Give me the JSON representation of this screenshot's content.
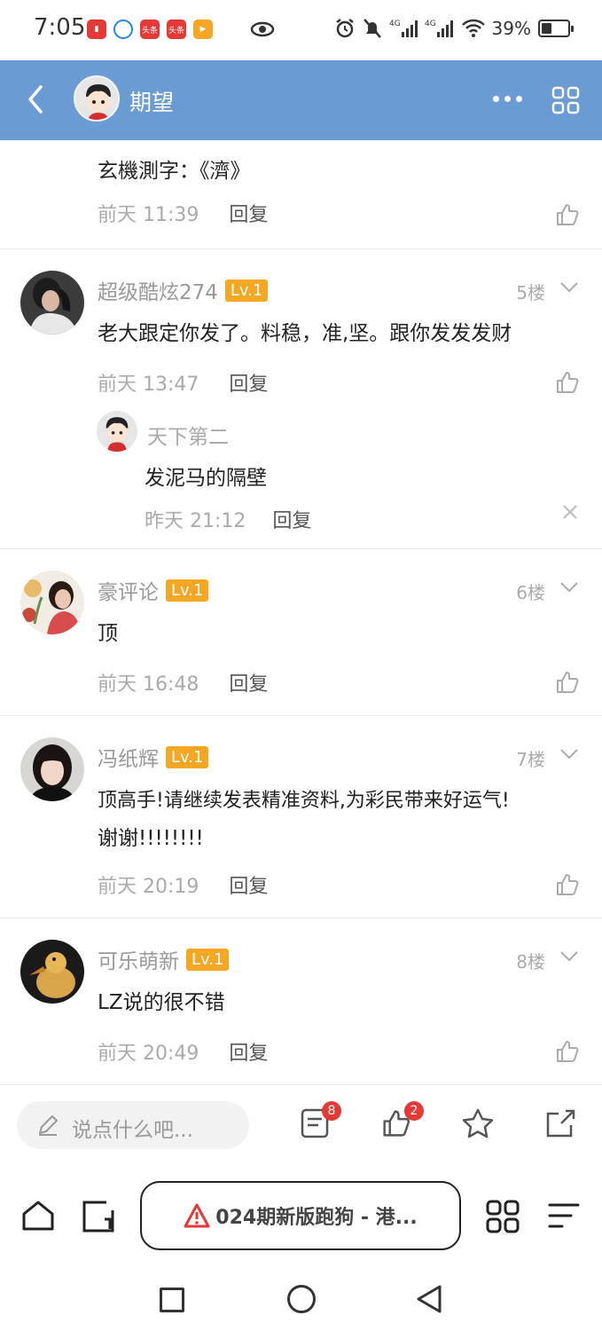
{
  "status_bar": {
    "time": "7:05",
    "notif_badges": [
      "头条",
      "头条"
    ],
    "signal_1": "4G",
    "signal_2": "4G",
    "battery": "39%"
  },
  "header": {
    "title": "期望"
  },
  "partial_comment": {
    "text": "玄機測字：《濟》",
    "time": "前天 11:39",
    "reply": "回复"
  },
  "comments": [
    {
      "username": "超级酷炫274",
      "level": "Lv.1",
      "floor": "5楼",
      "text": "老大跟定你发了。料稳，准,坚。跟你发发发财",
      "time": "前天 13:47",
      "reply": "回复",
      "sub_reply": {
        "username": "天下第二",
        "text": "发泥马的隔壁",
        "time": "昨天 21:12",
        "reply": "回复"
      }
    },
    {
      "username": "豪评论",
      "level": "Lv.1",
      "floor": "6楼",
      "text": "顶",
      "time": "前天 16:48",
      "reply": "回复"
    },
    {
      "username": "冯纸辉",
      "level": "Lv.1",
      "floor": "7楼",
      "text_line1": "顶高手!请继续发表精准资料,为彩民带来好运气!",
      "text_line2": "谢谢!!!!!!!!",
      "time": "前天 20:19",
      "reply": "回复"
    },
    {
      "username": "可乐萌新",
      "level": "Lv.1",
      "floor": "8楼",
      "text": "LZ说的很不错",
      "time": "前天 20:49",
      "reply": "回复"
    }
  ],
  "input_bar": {
    "placeholder": "说点什么吧...",
    "comment_badge": "8",
    "like_badge": "2"
  },
  "browser_bar": {
    "url_text": "024期新版跑狗 - 港..."
  },
  "colors": {
    "header": "#6a9bd3",
    "level_badge": "#f5a623",
    "badge_red": "#e53935",
    "warning_red": "#e53935"
  }
}
